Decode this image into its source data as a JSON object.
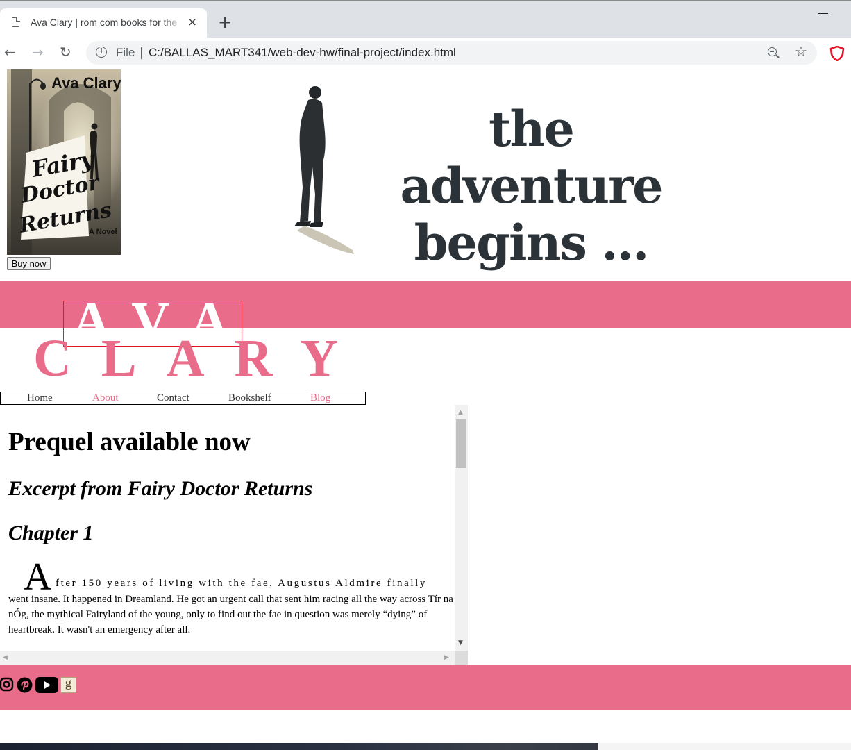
{
  "browser": {
    "tab_title": "Ava Clary | rom com books for the",
    "close_glyph": "×",
    "new_tab_glyph": "+",
    "url_scheme": "File",
    "url": "C:/BALLAS_MART341/web-dev-hw/final-project/index.html"
  },
  "header": {
    "cover": {
      "author": "Ava Clary",
      "title_lines": [
        "Fairy",
        "Doctor",
        "Returns"
      ],
      "subtitle": "A Novel"
    },
    "buy_button": "Buy now",
    "hero_lines": [
      "the adventure",
      "begins ..."
    ]
  },
  "brand": {
    "first_name": "AVA",
    "last_name": "CLARY"
  },
  "nav": {
    "items": [
      {
        "label": "Home",
        "color": "#333333"
      },
      {
        "label": "About",
        "color": "#e96c8a"
      },
      {
        "label": "Contact",
        "color": "#333333"
      },
      {
        "label": "Bookshelf",
        "color": "#333333"
      },
      {
        "label": "Blog",
        "color": "#e96c8a"
      }
    ]
  },
  "content": {
    "heading": "Prequel available now",
    "excerpt_heading": "Excerpt from Fairy Doctor Returns",
    "chapter_heading": "Chapter 1",
    "drop_cap": "A",
    "first_line": "fter 150 years of living with the fae, Augustus Aldmire finally",
    "lines": [
      "went insane. It happened in Dreamland. He got an urgent call that sent him racing all the way across Tír na",
      "nÓg, the mythical Fairyland of the young, only to find out the fae in question was merely “dying” of",
      "heartbreak. It wasn't an emergency after all."
    ]
  },
  "footer": {
    "social_icons": [
      "instagram-icon",
      "pinterest-icon",
      "youtube-icon",
      "goodreads-icon"
    ],
    "goodreads_glyph": "g"
  },
  "colors": {
    "brand_pink": "#e96c8a",
    "hero_text": "#2c3338"
  }
}
